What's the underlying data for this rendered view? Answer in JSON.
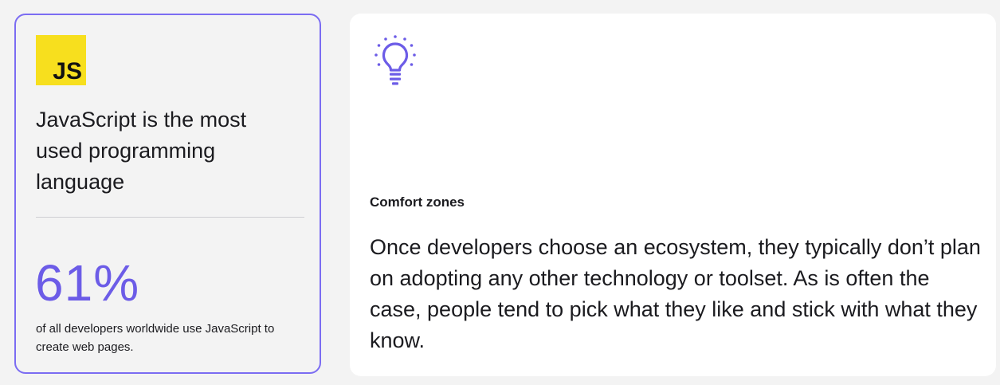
{
  "stat_card": {
    "logo_text": "JS",
    "headline": "JavaScript is the most used programming language",
    "stat_value": "61%",
    "stat_caption": "of all developers worldwide use JavaScript to create web pages."
  },
  "insight_card": {
    "icon": "lightbulb-icon",
    "title": "Comfort zones",
    "body": "Once developers choose an ecosystem, they typically don’t plan on adopting any other technology or toolset. As is often the case, people tend to pick what they like and stick with what they know."
  },
  "colors": {
    "accent": "#6c5ce7",
    "card_border": "#7b6cf2",
    "js_yellow": "#f7df1e",
    "background": "#f3f3f3"
  }
}
